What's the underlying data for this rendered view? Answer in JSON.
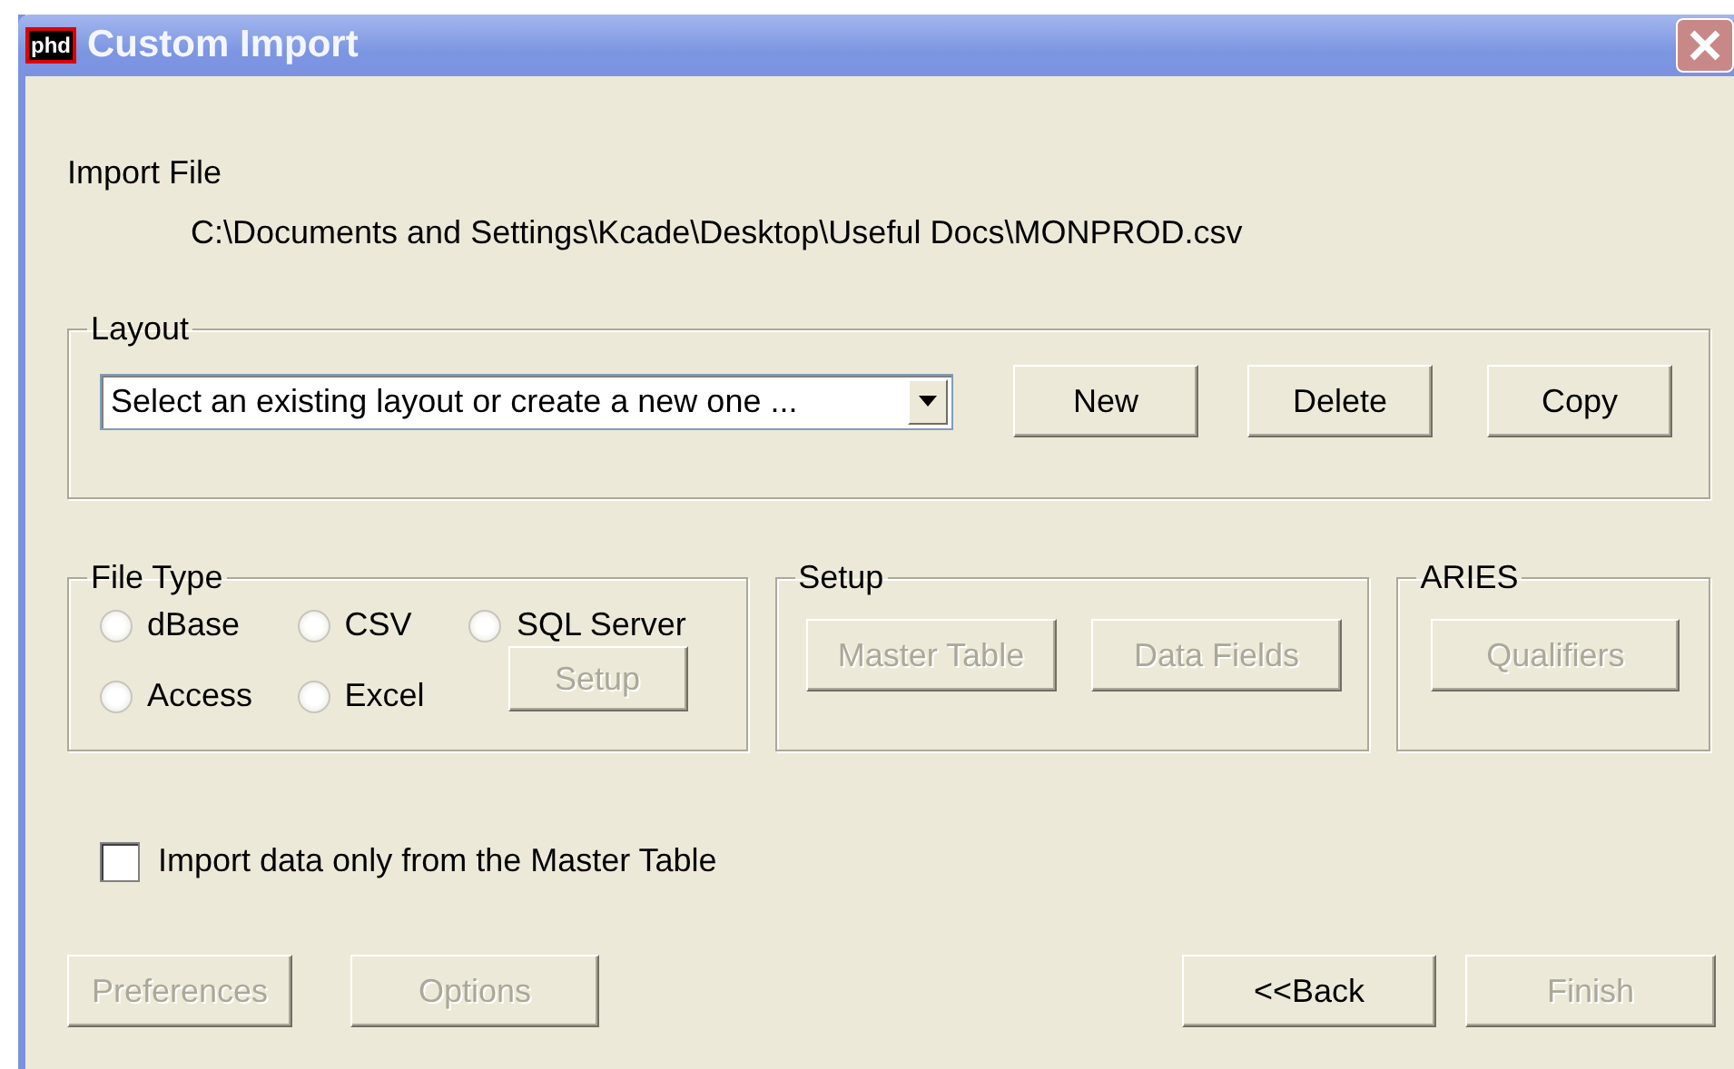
{
  "window": {
    "title": "Custom Import",
    "icon_text": "phd"
  },
  "import_file": {
    "label": "Import File",
    "path": "C:\\Documents and Settings\\Kcade\\Desktop\\Useful Docs\\MONPROD.csv"
  },
  "layout": {
    "label": "Layout",
    "dropdown": {
      "value": "Select an existing layout or create a new one ..."
    },
    "buttons": [
      {
        "label": "New",
        "disabled": false
      },
      {
        "label": "Delete",
        "disabled": false
      },
      {
        "label": "Copy",
        "disabled": false
      }
    ]
  },
  "file_type": {
    "label": "File Type",
    "options": [
      {
        "label": "dBase",
        "selected": false
      },
      {
        "label": "CSV",
        "selected": false
      },
      {
        "label": "SQL Server",
        "selected": false
      },
      {
        "label": "Access",
        "selected": false
      },
      {
        "label": "Excel",
        "selected": false
      }
    ],
    "setup_button": {
      "label": "Setup",
      "disabled": true
    }
  },
  "setup": {
    "label": "Setup",
    "buttons": [
      {
        "label": "Master Table",
        "disabled": true
      },
      {
        "label": "Data Fields",
        "disabled": true
      }
    ]
  },
  "aries": {
    "label": "ARIES",
    "buttons": [
      {
        "label": "Qualifiers",
        "disabled": true
      }
    ]
  },
  "master_only": {
    "label": "Import data only from the Master Table",
    "checked": false
  },
  "footer": {
    "left_buttons": [
      {
        "label": "Preferences",
        "disabled": true
      },
      {
        "label": "Options",
        "disabled": true
      }
    ],
    "right_buttons": [
      {
        "label": "<<Back",
        "disabled": false
      },
      {
        "label": "Finish",
        "disabled": true
      }
    ]
  }
}
